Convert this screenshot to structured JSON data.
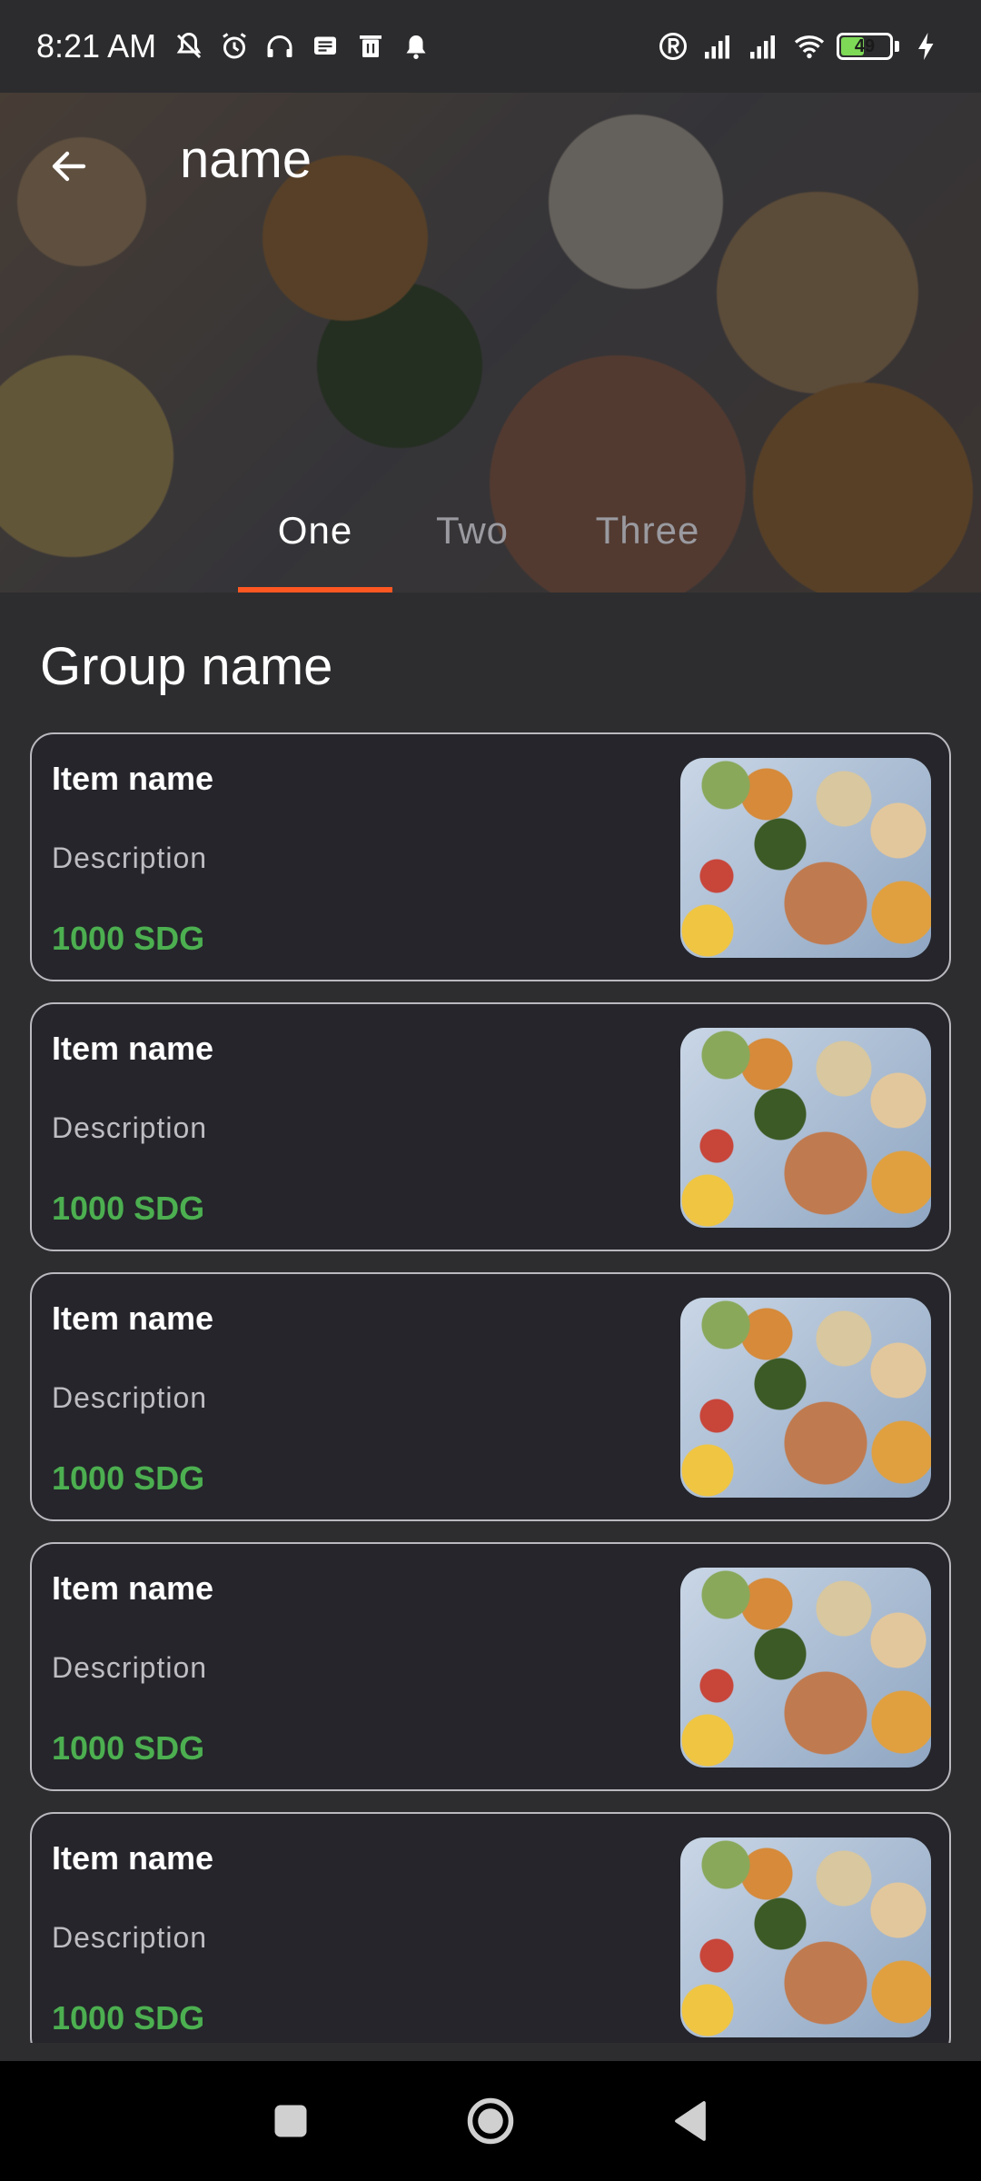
{
  "status_bar": {
    "time": "8:21 AM",
    "battery_level": "49",
    "battery_fraction": 0.49,
    "icons": [
      "muted-bell-icon",
      "alarm-icon",
      "headphones-icon",
      "message-icon",
      "trash-icon",
      "notification-bell-icon",
      "registered-icon",
      "signal-icon",
      "signal-icon",
      "wifi-icon",
      "battery-icon",
      "charging-icon"
    ]
  },
  "header": {
    "title": "name",
    "back_icon": "arrow-left-icon"
  },
  "tabs": [
    {
      "label": "One",
      "active": true
    },
    {
      "label": "Two",
      "active": false
    },
    {
      "label": "Three",
      "active": false
    }
  ],
  "colors": {
    "accent": "#ff5722",
    "price": "#4caf50",
    "background": "#2d2d2f",
    "card": "#25252b"
  },
  "group": {
    "title": "Group name",
    "items": [
      {
        "name": "Item name",
        "description": "Description",
        "price": "1000 SDG"
      },
      {
        "name": "Item name",
        "description": "Description",
        "price": "1000 SDG"
      },
      {
        "name": "Item name",
        "description": "Description",
        "price": "1000 SDG"
      },
      {
        "name": "Item name",
        "description": "Description",
        "price": "1000 SDG"
      },
      {
        "name": "Item name",
        "description": "Description",
        "price": "1000 SDG"
      }
    ]
  },
  "nav_bar": {
    "buttons": [
      "recents-square-icon",
      "home-circle-icon",
      "back-triangle-icon"
    ]
  }
}
